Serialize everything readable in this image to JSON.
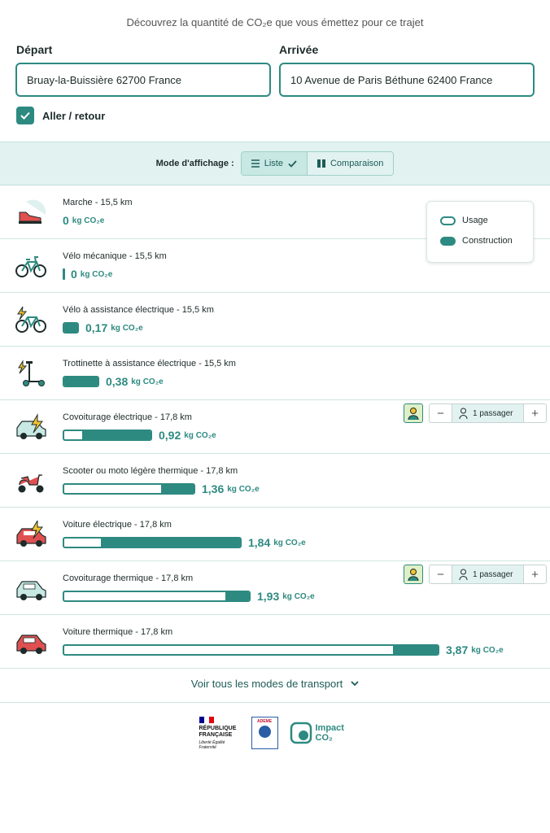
{
  "intro": "Découvrez la quantité de CO₂e que vous émettez pour ce trajet",
  "form": {
    "departure_label": "Départ",
    "departure_value": "Bruay-la-Buissière 62700 France",
    "arrival_label": "Arrivée",
    "arrival_value": "10 Avenue de Paris Béthune 62400 France",
    "round_trip_label": "Aller / retour",
    "round_trip_checked": true
  },
  "display_mode": {
    "label": "Mode d'affichage :",
    "options": [
      "Liste",
      "Comparaison"
    ],
    "selected": "Liste"
  },
  "legend": {
    "usage": "Usage",
    "construction": "Construction"
  },
  "unit": "kg CO₂e",
  "passenger_label": "1 passager",
  "modes": [
    {
      "title": "Marche - 15,5 km",
      "value": "0",
      "icon": "shoe-icon",
      "construction_fraction": 0
    },
    {
      "title": "Vélo mécanique - 15,5 km",
      "value": "0",
      "icon": "bicycle-icon",
      "construction_fraction": 1
    },
    {
      "title": "Vélo à assistance électrique - 15,5 km",
      "value": "0,17",
      "icon": "electric-bicycle-icon",
      "construction_fraction": 1
    },
    {
      "title": "Trottinette à assistance électrique - 15,5 km",
      "value": "0,38",
      "icon": "electric-scooter-icon",
      "construction_fraction": 1
    },
    {
      "title": "Covoiturage électrique - 17,8 km",
      "value": "0,92",
      "icon": "electric-carpool-icon",
      "construction_fraction": 0.79,
      "passenger": true
    },
    {
      "title": "Scooter ou moto légère thermique - 17,8 km",
      "value": "1,36",
      "icon": "motor-scooter-icon",
      "construction_fraction": 0.25
    },
    {
      "title": "Voiture électrique - 17,8 km",
      "value": "1,84",
      "icon": "electric-car-icon",
      "construction_fraction": 0.79
    },
    {
      "title": "Covoiturage thermique - 17,8 km",
      "value": "1,93",
      "icon": "thermal-carpool-icon",
      "construction_fraction": 0.13,
      "passenger": true
    },
    {
      "title": "Voiture thermique - 17,8 km",
      "value": "3,87",
      "icon": "thermal-car-icon",
      "construction_fraction": 0.12
    }
  ],
  "see_all": "Voir tous les modes de transport",
  "footer": {
    "republique": "RÉPUBLIQUE FRANÇAISE",
    "motto": "Liberté Égalité Fraternité",
    "ademe": "ADEME",
    "impact": "Impact CO₂"
  },
  "colors": {
    "accent": "#2d8a80",
    "band": "#e1f2f1",
    "icon_red": "#e05050",
    "passenger_badge": "#dff0c8"
  }
}
